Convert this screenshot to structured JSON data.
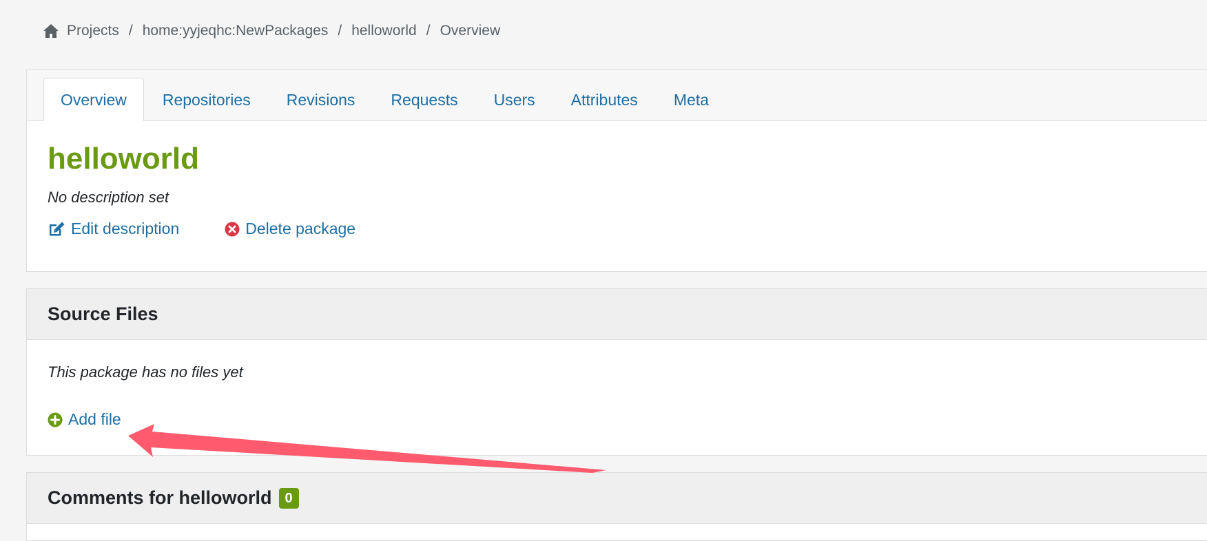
{
  "breadcrumb": {
    "items": [
      "Projects",
      "home:yyjeqhc:NewPackages",
      "helloworld",
      "Overview"
    ],
    "separator": "/"
  },
  "tabs": [
    {
      "label": "Overview",
      "active": true
    },
    {
      "label": "Repositories",
      "active": false
    },
    {
      "label": "Revisions",
      "active": false
    },
    {
      "label": "Requests",
      "active": false
    },
    {
      "label": "Users",
      "active": false
    },
    {
      "label": "Attributes",
      "active": false
    },
    {
      "label": "Meta",
      "active": false
    }
  ],
  "package": {
    "name": "helloworld",
    "description": "No description set",
    "edit_label": "Edit description",
    "delete_label": "Delete package"
  },
  "source_files": {
    "title": "Source Files",
    "empty_text": "This package has no files yet",
    "add_label": "Add file"
  },
  "comments": {
    "title": "Comments for helloworld",
    "count": "0"
  },
  "colors": {
    "link": "#1c6ea4",
    "title_green": "#6a9a12",
    "delete_red": "#dc3545",
    "annotation_arrow": "#ff5a6e"
  },
  "icons": {
    "home": "home-icon",
    "edit": "edit-icon",
    "delete": "times-circle-icon",
    "add": "plus-circle-icon"
  }
}
